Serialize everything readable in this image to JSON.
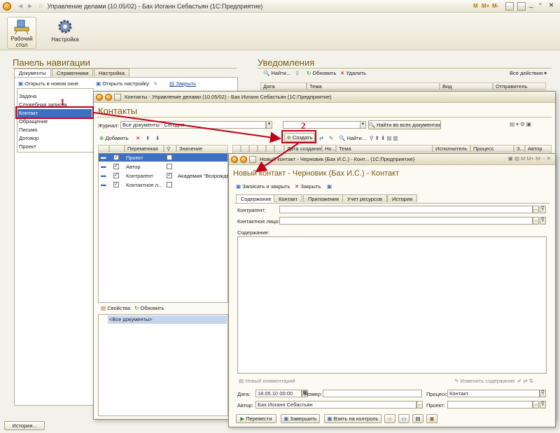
{
  "app": {
    "title": "Управление делами (10.05/02) - Бах Иоганн Себастьян (1С:Предприятие)",
    "top_icons": {
      "m": "M",
      "mplus": "M+",
      "mminus": "M-",
      "minimize": "_",
      "restore": "▫",
      "close": "×"
    }
  },
  "toolbar": {
    "desktop": "Рабочий стол",
    "desktop_line1": "Рабочий",
    "desktop_line2": "стол",
    "settings": "Настройка"
  },
  "nav": {
    "title": "Панель навигации",
    "tabs": [
      "Документы",
      "Справочники",
      "Настройка"
    ],
    "open_new_window": "Открыть в новом окне",
    "open_settings": "Открыть настройку",
    "close": "Закрыть",
    "items": [
      "Задача",
      "Служебная записка",
      "Контакт",
      "Обращение",
      "Письмо",
      "Договор",
      "Проект"
    ]
  },
  "notifications": {
    "title": "Уведомления",
    "find": "Найти...",
    "refresh": "Обновить",
    "delete": "Удалить",
    "all_actions": "Все действия ▾",
    "columns": [
      "Дата",
      "Тема",
      "Вид",
      "Отправитель"
    ]
  },
  "contacts": {
    "window_title": "Контакты - Управление делами (10.05/02) - Бах Иоганн Себастьян (1С:Предприятие)",
    "title": "Контакты",
    "journal_label": "Журнал:",
    "journal_value": "Все документы - Сегодня",
    "find_all": "Найти во всех документах",
    "add": "Добавить",
    "create": "Создать",
    "find": "Найти...",
    "left_columns": [
      "Переменная",
      "Значение"
    ],
    "rows": [
      {
        "name": "Проект",
        "checked": true,
        "checked2": false,
        "value": ""
      },
      {
        "name": "Автор",
        "checked": true,
        "checked2": false,
        "value": ""
      },
      {
        "name": "Контрагент",
        "checked": true,
        "checked2": true,
        "value": "Академия \"Возрожде"
      },
      {
        "name": "Контактное л...",
        "checked": true,
        "checked2": false,
        "value": ""
      }
    ],
    "right_columns": [
      "Дата создания",
      "Но...",
      "Тема",
      "Исполнитель",
      "Процесс",
      "З...",
      "Автор"
    ],
    "properties": "Свойства",
    "refresh": "Обновить",
    "all_docs": "<Все документы>"
  },
  "new_contact": {
    "window_title": "Новый контакт - Черновик (Бах И.С.) - Конт... (1С:Предприятие)",
    "title": "Новый контакт - Черновик (Бах И.С.) - Контакт",
    "save_close": "Записать и закрыть",
    "close": "Закрыть",
    "tabs": [
      "Содержание",
      "Контакт",
      "Приложения",
      "Учет ресурсов",
      "История"
    ],
    "counterparty_label": "Контрагент:",
    "contact_person_label": "Контактное лицо:",
    "content_label": "Содержание:",
    "new_comment": "Новый комментарий",
    "edit_content": "Изменить содержание",
    "date_label": "Дата:",
    "date_value": "18.05.10 00:00",
    "number_label": "Номер:",
    "process_label": "Процесс:",
    "process_value": "Контакт",
    "author_label": "Автор:",
    "author_value": "Бах Иоганн Себастьян",
    "project_label": "Проект:",
    "buttons": [
      "Перевести",
      "Завершить",
      "Взять на контроль"
    ]
  },
  "history_button": "История...",
  "annotations": [
    "1",
    "2"
  ],
  "colors": {
    "accent": "#7a5a10",
    "selection": "#3f6fc2",
    "annotation": "#c00018"
  }
}
